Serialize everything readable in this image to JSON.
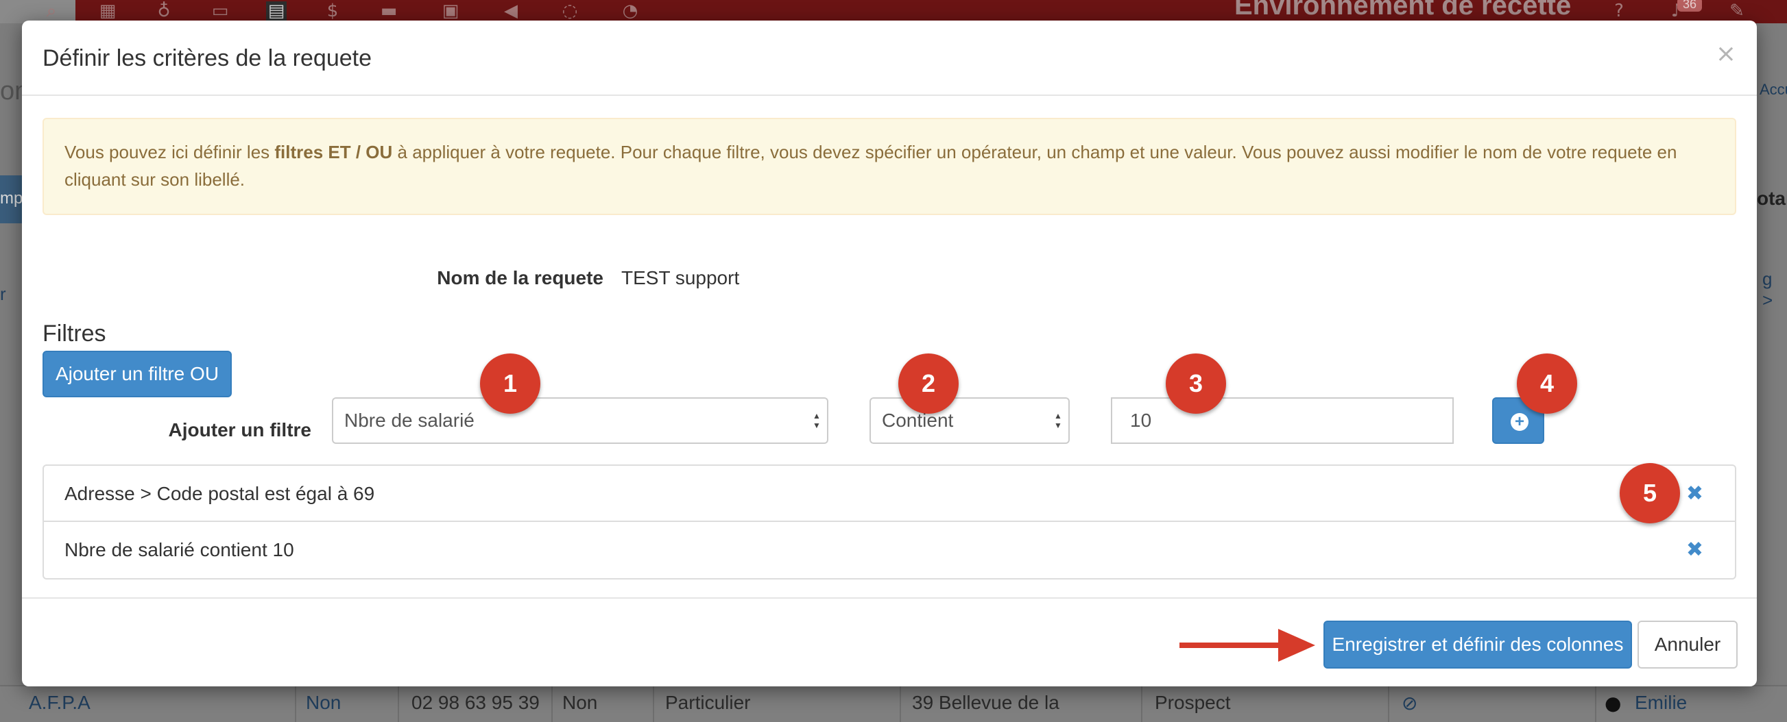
{
  "app": {
    "env_title": "Environnement de recette",
    "notif_count": "36",
    "nav_icons": [
      "search-icon",
      "calendar-icon",
      "lightbulb-icon",
      "money-icon",
      "building-icon",
      "dollar-icon",
      "archive-icon",
      "briefcase-icon",
      "megaphone-icon",
      "comments-icon",
      "dashboard-icon"
    ],
    "edge_left": [
      "on",
      "mpt",
      "r"
    ],
    "edge_right": [
      "Accu",
      "otal",
      "g >"
    ]
  },
  "background_row": {
    "company": "A.F.P.A",
    "flag1": "Non",
    "phone": "02 98 63 95 39",
    "flag2": "Non",
    "type": "Particulier",
    "address": "39 Bellevue de la",
    "status": "Prospect",
    "owner": "Emilie"
  },
  "modal": {
    "title": "Définir les critères de la requete",
    "close": "×",
    "alert": {
      "part1": "Vous pouvez ici définir les ",
      "bold": "filtres ET / OU",
      "part2": " à appliquer à votre requete. Pour chaque filtre, vous devez spécifier un opérateur, un champ et une valeur. Vous pouvez aussi modifier le nom de votre requete en cliquant sur son libellé."
    },
    "query_name_label": "Nom de la requete",
    "query_name_value": "TEST support",
    "filters_title": "Filtres",
    "add_or_filter_button": "Ajouter un filtre OU",
    "add_filter_label": "Ajouter un filtre",
    "field_select": "Nbre de salarié",
    "operator_select": "Contient",
    "value_input": "10",
    "filters": [
      {
        "text": "Adresse > Code postal est égal à 69",
        "remove": "✖"
      },
      {
        "text": "Nbre de salarié contient 10",
        "remove": "✖"
      }
    ],
    "save_button": "Enregistrer et définir des colonnes",
    "cancel_button": "Annuler"
  },
  "markers": [
    "1",
    "2",
    "3",
    "4",
    "5"
  ],
  "colors": {
    "primary": "#428bca",
    "marker": "#d63b2a",
    "alert_bg": "#fcf8e3",
    "alert_text": "#8a6d3b",
    "topbar": "#6b1414"
  }
}
